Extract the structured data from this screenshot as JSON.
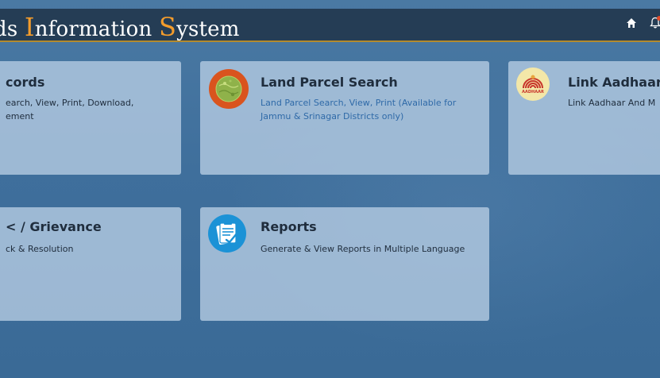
{
  "header": {
    "title_prefix": "ds ",
    "title_cap1": "I",
    "title_mid": "nformation ",
    "title_cap2": "S",
    "title_suffix": "ystem"
  },
  "nav": {
    "home_icon": "home-icon",
    "notification_icon": "bell-icon"
  },
  "cards": [
    {
      "title": "cords",
      "description_line1": "earch, View, Print, Download,",
      "description_line2": "ement"
    },
    {
      "title": "Land Parcel Search",
      "description": "Land Parcel Search, View, Print (Available for Jammu & Srinagar Districts only)",
      "icon": "land-parcel-globe-icon"
    },
    {
      "title": "Link Aadhaar",
      "description": "Link Aadhaar And M",
      "icon_label": "AADHAAR",
      "icon": "aadhaar-logo-icon"
    },
    {
      "title": "< / Grievance",
      "description": "ck & Resolution"
    },
    {
      "title": "Reports",
      "description": "Generate & View Reports in Multiple Language",
      "icon": "reports-clipboard-icon"
    }
  ],
  "colors": {
    "background": "#3d6f9a",
    "header": "#253d55",
    "header_accent": "#b38a2e",
    "title_cap": "#f39c2c",
    "card": "#b2c9e0",
    "card_title": "#1f2d3d",
    "link_text": "#2f6aa8"
  }
}
